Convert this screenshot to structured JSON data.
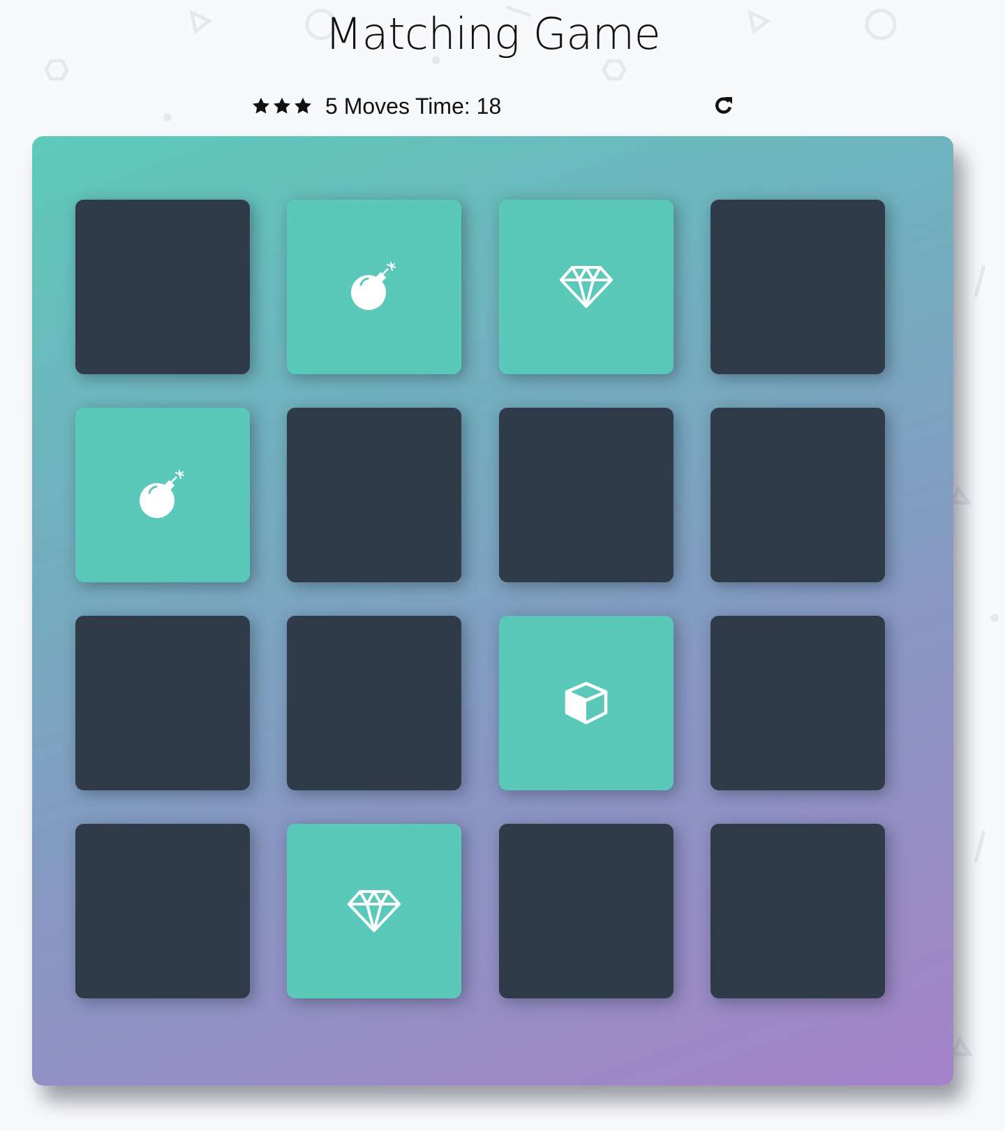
{
  "header": {
    "title": "Matching Game"
  },
  "score_panel": {
    "stars": 3,
    "moves_text": "5 Moves",
    "time_text": "Time: 18",
    "restart_icon": "refresh-icon"
  },
  "colors": {
    "page_background": "#f8f9fb",
    "card_closed": "#2f3b49",
    "card_open": "#5ac9b9",
    "deck_gradient_start": "#5ecabb",
    "deck_gradient_end": "#a583c8",
    "icon_color": "#ffffff"
  },
  "deck": {
    "rows": 4,
    "columns": 4,
    "cards": [
      {
        "state": "closed",
        "icon": ""
      },
      {
        "state": "open",
        "icon": "bomb-icon"
      },
      {
        "state": "open",
        "icon": "diamond-icon"
      },
      {
        "state": "closed",
        "icon": ""
      },
      {
        "state": "open",
        "icon": "bomb-icon"
      },
      {
        "state": "closed",
        "icon": ""
      },
      {
        "state": "closed",
        "icon": ""
      },
      {
        "state": "closed",
        "icon": ""
      },
      {
        "state": "closed",
        "icon": ""
      },
      {
        "state": "closed",
        "icon": ""
      },
      {
        "state": "open",
        "icon": "cube-icon"
      },
      {
        "state": "closed",
        "icon": ""
      },
      {
        "state": "closed",
        "icon": ""
      },
      {
        "state": "open",
        "icon": "diamond-icon"
      },
      {
        "state": "closed",
        "icon": ""
      },
      {
        "state": "closed",
        "icon": ""
      }
    ]
  }
}
